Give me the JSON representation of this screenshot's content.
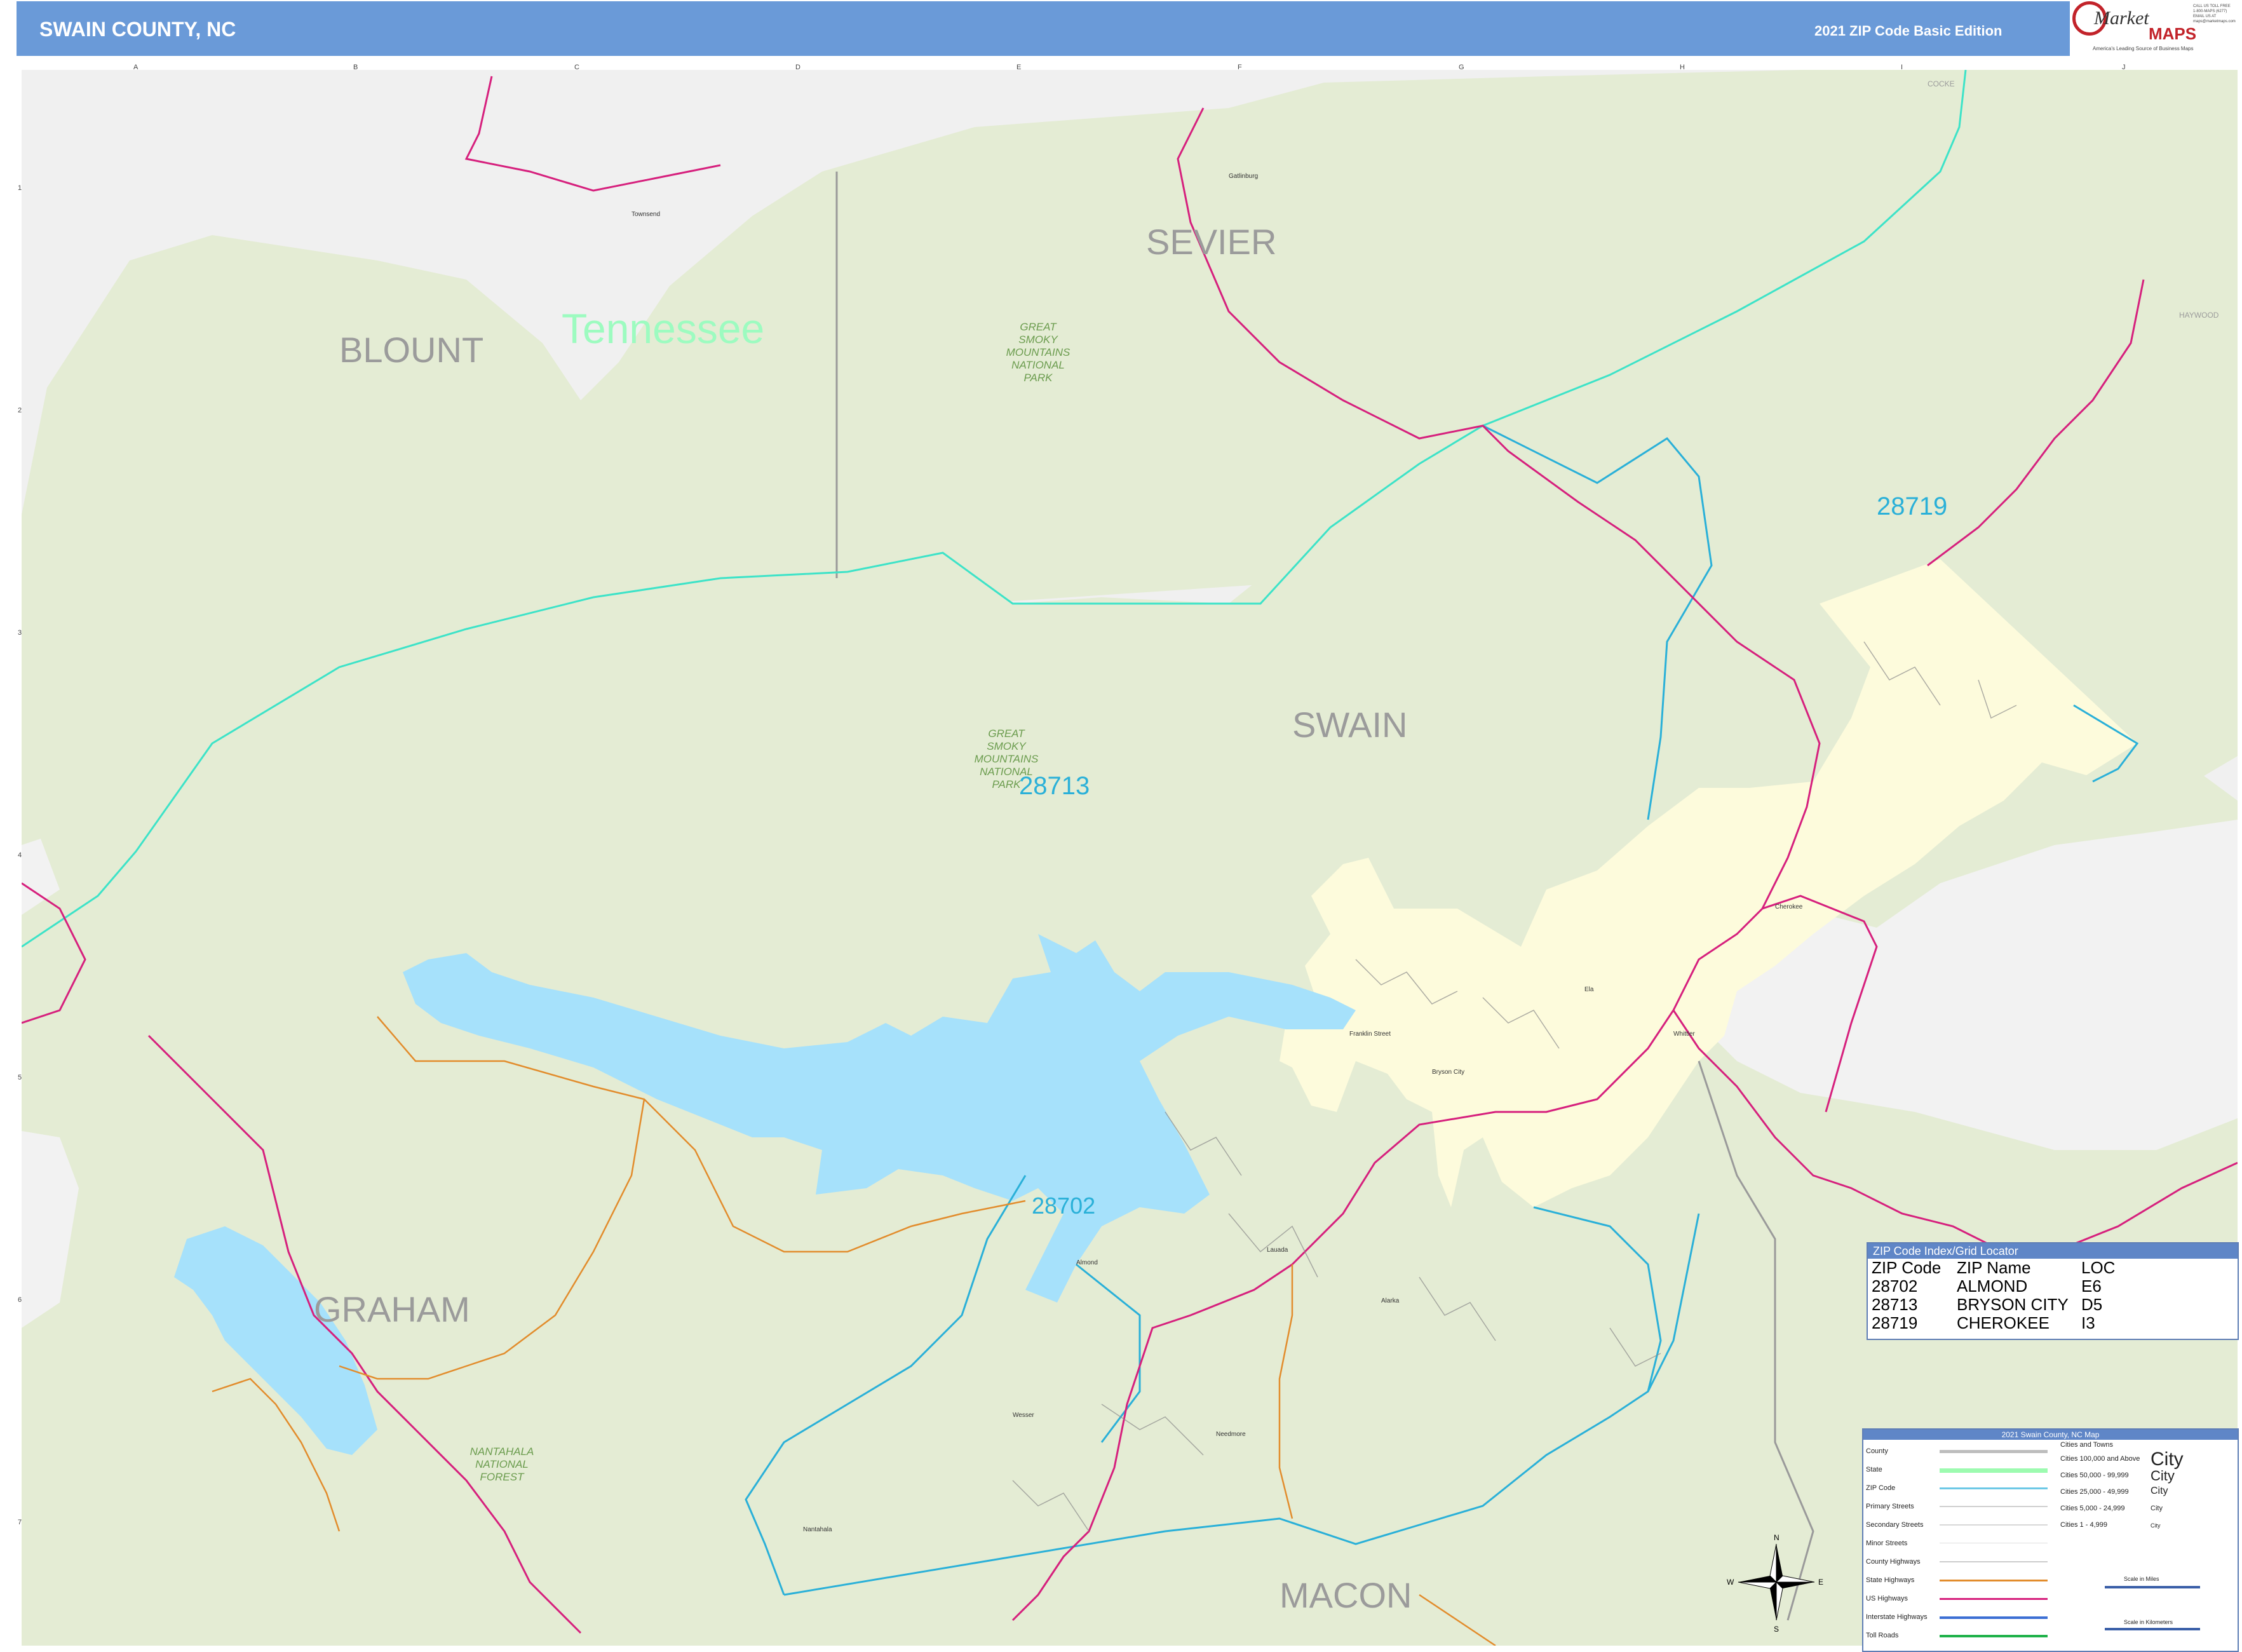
{
  "header": {
    "title": "SWAIN COUNTY, NC",
    "edition": "2021 ZIP Code Basic Edition"
  },
  "logo": {
    "market": "Market",
    "maps": "MAPS",
    "tagline": "America's Leading Source of Business Maps",
    "contact": [
      "CALL US TOLL FREE",
      "1-800-MAPS (6277)",
      "EMAIL US AT",
      "maps@marketmaps.com"
    ]
  },
  "map": {
    "state_label": "Tennessee",
    "counties": [
      "BLOUNT",
      "SEVIER",
      "SWAIN",
      "GRAHAM",
      "MACON"
    ],
    "small_counties": [
      "COCKE",
      "HAYWOOD"
    ],
    "parks": [
      [
        "GREAT",
        "SMOKY",
        "MOUNTAINS",
        "NATIONAL",
        "PARK"
      ],
      [
        "GREAT",
        "SMOKY",
        "MOUNTAINS",
        "NATIONAL",
        "PARK"
      ],
      [
        "NANTAHALA",
        "NATIONAL",
        "FOREST"
      ]
    ],
    "zips": [
      "28719",
      "28713",
      "28702"
    ],
    "places": [
      "Bryson City",
      "Cherokee",
      "Almond",
      "Whittier",
      "Ela",
      "Franklin Street",
      "Lauada",
      "Wesser",
      "Nantahala",
      "Needmore",
      "Alarka",
      "Gatlinburg",
      "Townsend"
    ],
    "colors": {
      "land": "#e4ecd4",
      "outside": "#f0f0f0",
      "zip_fill": "#fdfbdc",
      "water": "#a6e1fb",
      "zip_line": "#2ab0d8",
      "state_line": "#3de3c8",
      "us_highway": "#d6207d",
      "state_highway": "#e28c2c",
      "county_line": "#9a9a9a"
    }
  },
  "grid": {
    "columns": [
      "A",
      "B",
      "C",
      "D",
      "E",
      "F",
      "G",
      "H",
      "I",
      "J"
    ],
    "rows": [
      "1",
      "2",
      "3",
      "4",
      "5",
      "6",
      "7"
    ]
  },
  "zip_index": {
    "title": "ZIP Code Index/Grid Locator",
    "headers": [
      "ZIP Code",
      "ZIP Name",
      "LOC"
    ],
    "rows": [
      [
        "28702",
        "ALMOND",
        "E6"
      ],
      [
        "28713",
        "BRYSON CITY",
        "D5"
      ],
      [
        "28719",
        "CHEROKEE",
        "I3"
      ]
    ]
  },
  "legend": {
    "title": "2021 Swain County, NC Map",
    "items": [
      "County",
      "State",
      "ZIP Code",
      "Primary Streets",
      "Secondary Streets",
      "Minor Streets",
      "County Highways",
      "State Highways",
      "US Highways",
      "Interstate Highways",
      "Toll Roads"
    ],
    "cities_title": "Cities and Towns",
    "city_classes": [
      [
        "Cities 100,000 and Above",
        "City"
      ],
      [
        "Cities 50,000 - 99,999",
        "City"
      ],
      [
        "Cities 25,000 - 49,999",
        "City"
      ],
      [
        "Cities 5,000 - 24,999",
        "City"
      ],
      [
        "Cities 1 - 4,999",
        "City"
      ]
    ],
    "scale_miles": "Scale in Miles",
    "scale_km": "Scale in Kilometers",
    "compass": [
      "N",
      "S",
      "E",
      "W"
    ]
  }
}
